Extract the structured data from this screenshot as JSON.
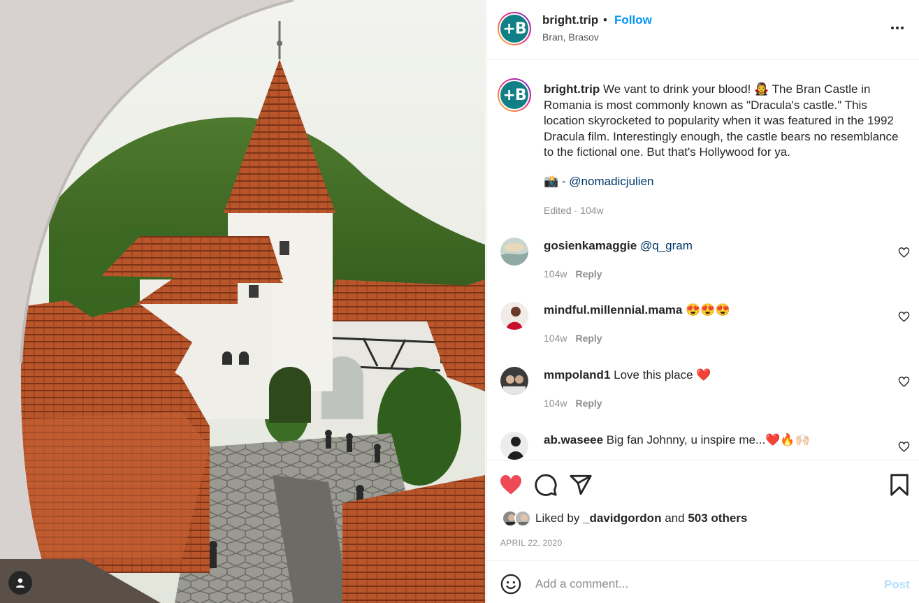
{
  "post": {
    "photo_alt_icon": "user-tag-icon"
  },
  "header": {
    "username": "bright.trip",
    "separator": "•",
    "follow_label": "Follow",
    "location": "Bran, Brasov",
    "avatar_letter": "+B"
  },
  "caption": {
    "username": "bright.trip",
    "text": "We vant to drink your blood! 🧛‍♀️ The Bran Castle in Romania is most commonly known as \"Dracula's castle.\" This location skyrocketed to popularity when it was featured in the 1992 Dracula film. Interestingly enough, the castle bears no resemblance to the fictional one. But that's Hollywood for ya.",
    "credit_emoji": "📸",
    "credit_sep": " - ",
    "credit_mention": "@nomadicjulien",
    "edited": "Edited",
    "dot": "·",
    "age": "104w"
  },
  "comments": [
    {
      "username": "gosienkamaggie",
      "text": "",
      "mention": "@q_gram",
      "age": "104w",
      "reply": "Reply"
    },
    {
      "username": "mindful.millennial.mama",
      "text": "😍😍😍",
      "mention": "",
      "age": "104w",
      "reply": "Reply"
    },
    {
      "username": "mmpoland1",
      "text": "Love this place ❤️",
      "mention": "",
      "age": "104w",
      "reply": "Reply"
    },
    {
      "username": "ab.waseee",
      "text": "Big fan Johnny, u inspire me...❤️🔥🙌🏻",
      "mention": "",
      "age": "",
      "reply": ""
    }
  ],
  "likes": {
    "prefix": "Liked by",
    "first_liker": "_davidgordon",
    "conj": "and",
    "others": "503 others"
  },
  "date": "APRIL 22, 2020",
  "add_comment": {
    "placeholder": "Add a comment...",
    "post_label": "Post"
  },
  "colors": {
    "like_red": "#ed4956",
    "follow_blue": "#0095f6",
    "mention_blue": "#00376b",
    "avatar_teal": "#117f86"
  }
}
